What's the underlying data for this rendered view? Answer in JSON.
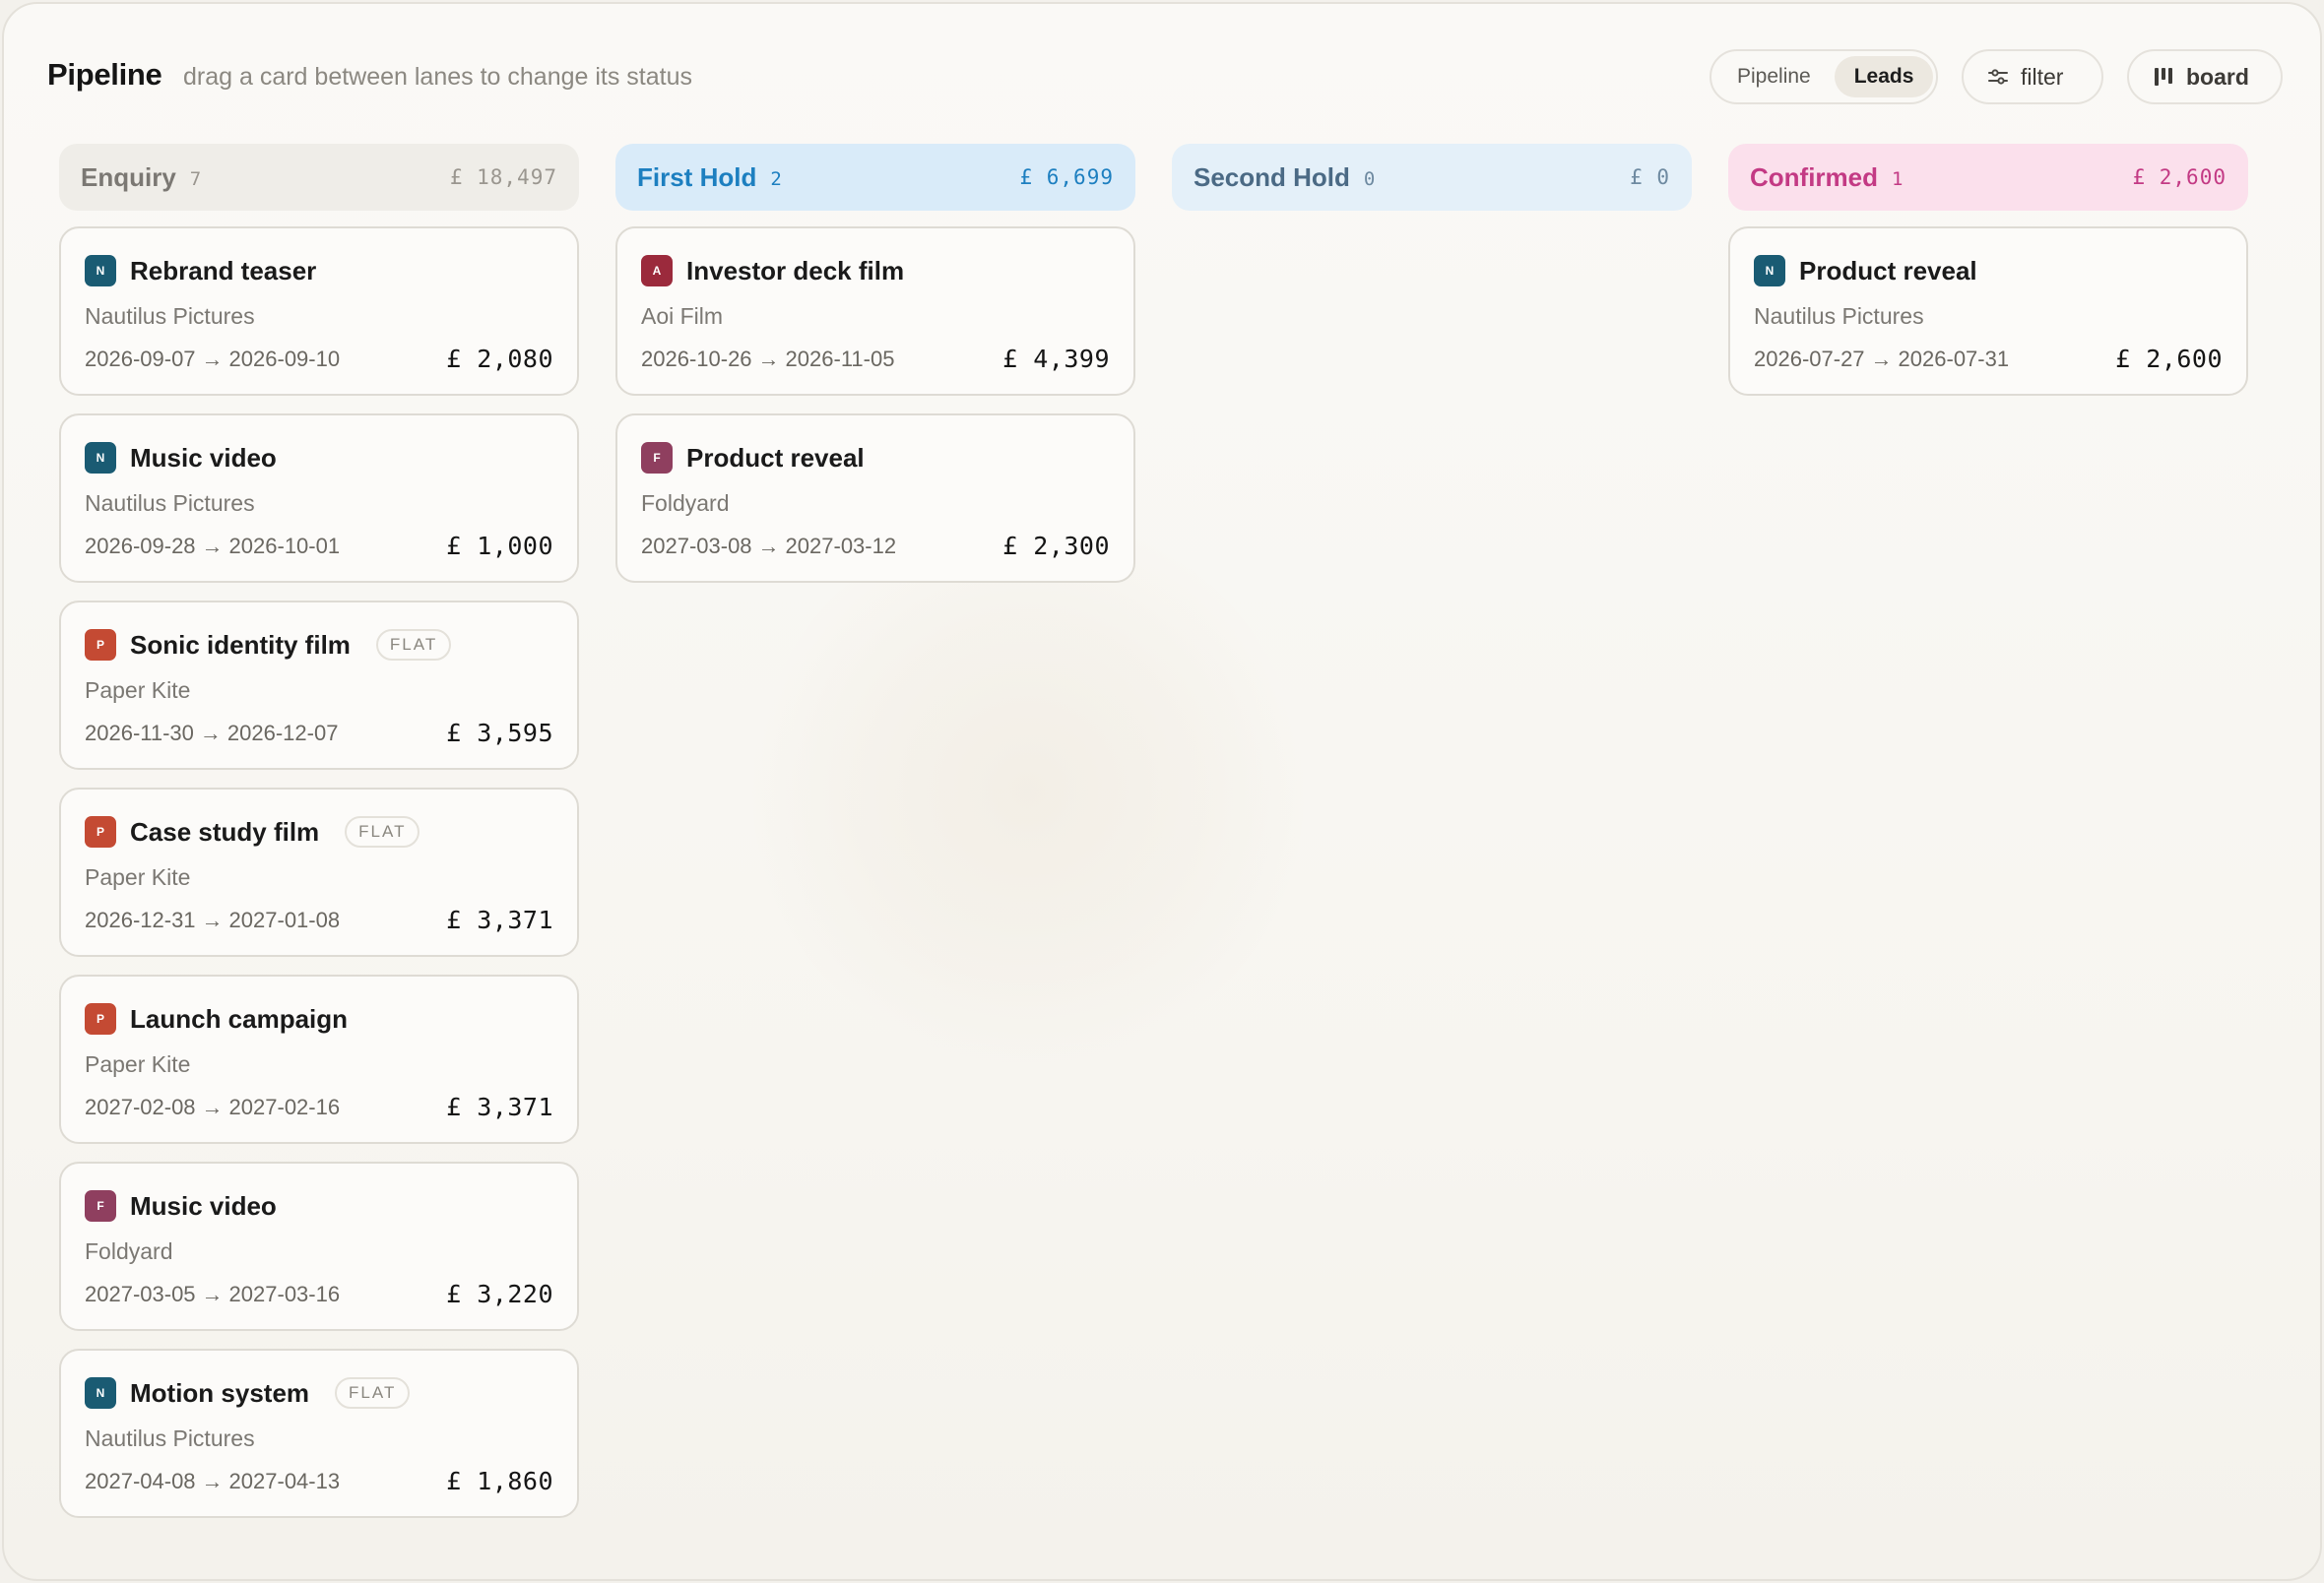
{
  "header": {
    "title": "Pipeline",
    "subtitle": "drag a card between lanes to change its status",
    "view_toggle": [
      {
        "label": "Pipeline",
        "active": false
      },
      {
        "label": "Leads",
        "active": true
      }
    ],
    "filter_label": "filter",
    "filter_icon": "sliders-icon",
    "board_label": "board",
    "board_icon": "kanban-icon"
  },
  "colors": {
    "client_N": "#1a5b73",
    "client_P": "#c44a33",
    "client_F": "#8f3f5f",
    "client_A": "#9b2a3c",
    "first_hold_accent": "#1d7fc0",
    "confirmed_accent": "#c33a84"
  },
  "lanes": [
    {
      "name": "Enquiry",
      "count": "7",
      "total": "£ 18,497",
      "cards": [
        {
          "initial": "N",
          "title": "Rebrand teaser",
          "tag": "",
          "client": "Nautilus Pictures",
          "start": "2026-09-07",
          "end": "2026-09-10",
          "amount": "£ 2,080"
        },
        {
          "initial": "N",
          "title": "Music video",
          "tag": "",
          "client": "Nautilus Pictures",
          "start": "2026-09-28",
          "end": "2026-10-01",
          "amount": "£ 1,000"
        },
        {
          "initial": "P",
          "title": "Sonic identity film",
          "tag": "FLAT",
          "client": "Paper Kite",
          "start": "2026-11-30",
          "end": "2026-12-07",
          "amount": "£ 3,595"
        },
        {
          "initial": "P",
          "title": "Case study film",
          "tag": "FLAT",
          "client": "Paper Kite",
          "start": "2026-12-31",
          "end": "2027-01-08",
          "amount": "£ 3,371"
        },
        {
          "initial": "P",
          "title": "Launch campaign",
          "tag": "",
          "client": "Paper Kite",
          "start": "2027-02-08",
          "end": "2027-02-16",
          "amount": "£ 3,371"
        },
        {
          "initial": "F",
          "title": "Music video",
          "tag": "",
          "client": "Foldyard",
          "start": "2027-03-05",
          "end": "2027-03-16",
          "amount": "£ 3,220"
        },
        {
          "initial": "N",
          "title": "Motion system",
          "tag": "FLAT",
          "client": "Nautilus Pictures",
          "start": "2027-04-08",
          "end": "2027-04-13",
          "amount": "£ 1,860"
        }
      ]
    },
    {
      "name": "First Hold",
      "count": "2",
      "total": "£ 6,699",
      "cards": [
        {
          "initial": "A",
          "title": "Investor deck film",
          "tag": "",
          "client": "Aoi Film",
          "start": "2026-10-26",
          "end": "2026-11-05",
          "amount": "£ 4,399"
        },
        {
          "initial": "F",
          "title": "Product reveal",
          "tag": "",
          "client": "Foldyard",
          "start": "2027-03-08",
          "end": "2027-03-12",
          "amount": "£ 2,300"
        }
      ]
    },
    {
      "name": "Second Hold",
      "count": "0",
      "total": "£ 0",
      "cards": []
    },
    {
      "name": "Confirmed",
      "count": "1",
      "total": "£ 2,600",
      "cards": [
        {
          "initial": "N",
          "title": "Product reveal",
          "tag": "",
          "client": "Nautilus Pictures",
          "start": "2026-07-27",
          "end": "2026-07-31",
          "amount": "£ 2,600"
        }
      ]
    }
  ],
  "date_arrow": "→"
}
